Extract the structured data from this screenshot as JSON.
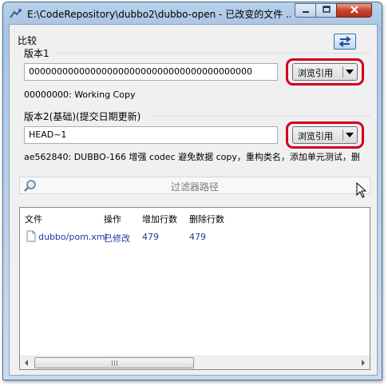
{
  "window": {
    "title": "E:\\CodeRepository\\dubbo2\\dubbo-open - 已改变的文件 ...",
    "buttons": {
      "minimize": "minimize-icon",
      "maximize": "maximize-icon",
      "close": "close-icon"
    }
  },
  "compare": {
    "heading": "比较",
    "version1": {
      "label": "版本1",
      "value": "0000000000000000000000000000000000000000",
      "browse_label": "浏览引用",
      "info": "00000000: Working Copy"
    },
    "version2": {
      "label": "版本2(基础)(提交日期更新)",
      "value": "HEAD~1",
      "browse_label": "浏览引用",
      "info": "ae562840: DUBBO-166 增强 codec 避免数据 copy，重构类名，添加单元测试，删"
    }
  },
  "filter": {
    "placeholder": "过滤器路径"
  },
  "file_list": {
    "columns": [
      "文件",
      "操作",
      "增加行数",
      "删除行数"
    ],
    "rows": [
      {
        "file": "dubbo/pom.xml",
        "action": "已修改",
        "added": "479",
        "removed": "479"
      }
    ]
  },
  "colors": {
    "highlight": "#d0001e",
    "link": "#1a3e9e"
  }
}
